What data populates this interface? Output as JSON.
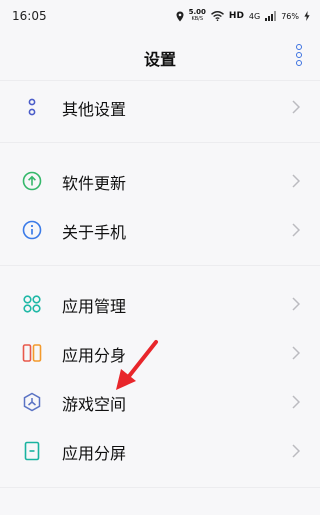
{
  "status_bar": {
    "time": "16:05",
    "net_speed_value": "5.00",
    "net_speed_unit": "KB/S",
    "hd": "HD",
    "signal": "4G",
    "battery": "76%"
  },
  "header": {
    "title": "设置"
  },
  "menu": {
    "other_settings": "其他设置",
    "software_update": "软件更新",
    "about_phone": "关于手机",
    "app_management": "应用管理",
    "app_clone": "应用分身",
    "game_space": "游戏空间",
    "split_screen": "应用分屏"
  },
  "icons": {
    "other_settings": "dots-vertical-icon",
    "software_update": "update-arrow-icon",
    "about_phone": "info-icon",
    "app_management": "app-grid-icon",
    "app_clone": "app-clone-icon",
    "game_space": "game-space-icon",
    "split_screen": "split-screen-icon",
    "chevron": "chevron-right-icon"
  },
  "colors": {
    "accent_blue": "#3d72e0",
    "update_green": "#35b86b",
    "info_blue": "#3b7be8",
    "grid_teal": "#1fb8a6",
    "clone_orange": "#f39a2c",
    "clone_red": "#e8584b",
    "game_blue": "#5a73c4",
    "split_teal": "#19b3a0",
    "annotation_red": "#e8262b"
  }
}
